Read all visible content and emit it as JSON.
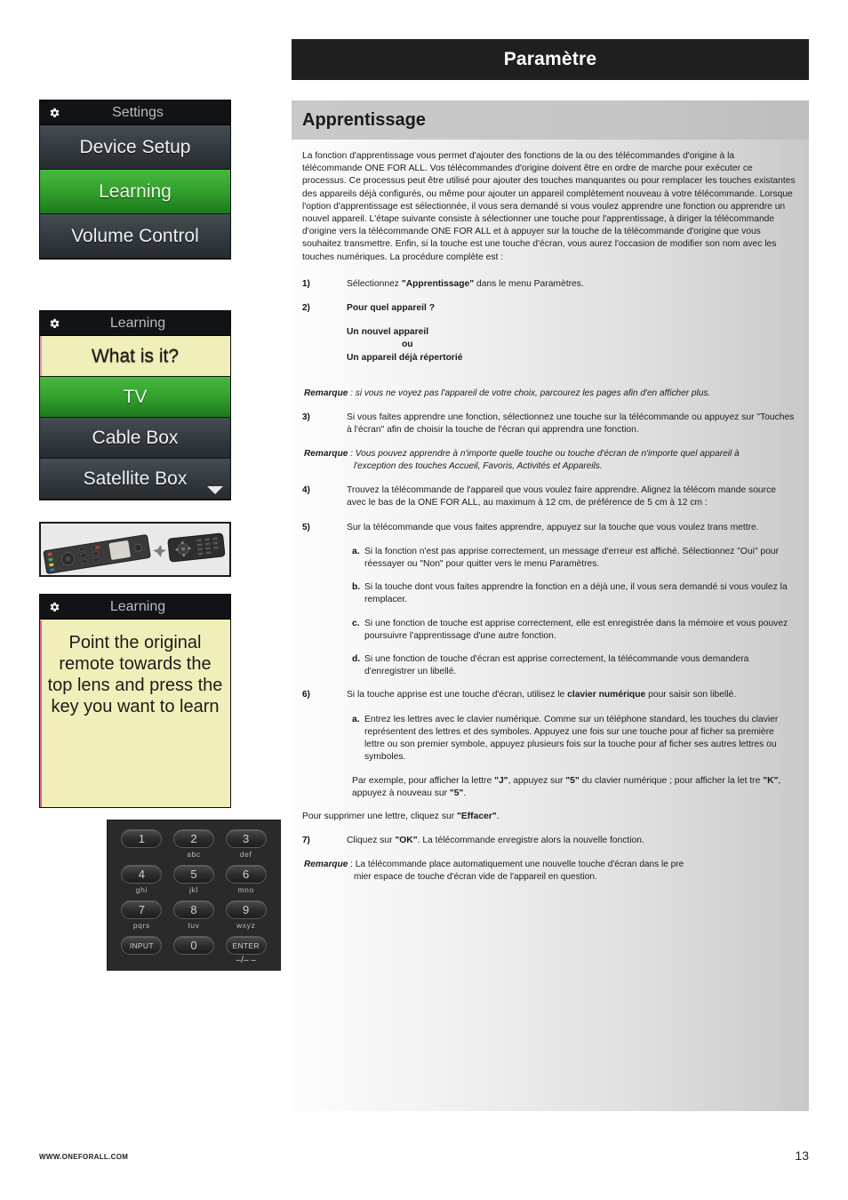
{
  "header": {
    "title": "Paramètre"
  },
  "section": {
    "title": "Apprentissage"
  },
  "intro": "La fonction d'apprentissage vous permet d'ajouter des fonctions de la ou des télécommandes d'origine à la télécommande ONE FOR ALL. Vos télécommandes d'origine doivent être en ordre de marche pour exécuter ce processus. Ce processus peut être utilisé pour ajouter des touches manquantes ou pour remplacer les touches existantes des appareils déjà configurés, ou même pour ajouter un appareil complètement nouveau à votre télécommande. Lorsque l'option d'apprentissage est sélectionnée, il vous sera demandé si vous voulez apprendre une fonction ou apprendre un nouvel appareil. L'étape suivante consiste à sélectionner une touche pour l'apprentissage, à diriger la télécommande d'origine vers la télécommande ONE FOR ALL et à appuyer sur la touche de la télécommande d'origine que vous souhaitez transmettre. Enfin, si la touche est une touche d'écran, vous aurez l'occasion de modifier son nom avec les touches numériques. La procédure complète est :",
  "steps": {
    "s1_num": "1)",
    "s1_a": "Sélectionnez ",
    "s1_b": "\"Apprentissage\"",
    "s1_c": " dans le menu Paramètres.",
    "s2_num": "2)",
    "s2_text": "Pour quel appareil ?",
    "s2_opt1": "Un nouvel appareil",
    "s2_or": "ou",
    "s2_opt2": "Un appareil déjà répertorié",
    "rem1_label": "Remarque",
    "rem1_text": " : si vous ne voyez pas l'appareil de votre choix, parcourez les pages afin d'en afficher plus.",
    "s3_num": "3)",
    "s3_text": "Si vous faites apprendre une fonction, sélectionnez une touche sur la télécommande ou appuyez sur \"Touches à l'écran\" afin de choisir la touche de l'écran qui apprendra une fonction.",
    "rem2_label": "Remarque",
    "rem2_text": " : Vous pouvez apprendre à n'importe quelle touche ou touche d'écran de n'importe quel appareil à",
    "rem2_text2": "l'exception des touches Accueil, Favoris, Activités et Appareils.",
    "s4_num": "4)",
    "s4_text": "Trouvez la télécommande de l'appareil que vous voulez faire apprendre. Alignez la télécom mande source avec le bas de la ONE FOR ALL, au maximum à 12 cm, de préférence de 5 cm à 12 cm :",
    "s5_num": "5)",
    "s5_text": "Sur la télécommande que vous faites apprendre, appuyez sur la touche que vous voulez trans mettre.",
    "s5a_ltr": "a.",
    "s5a_text": "Si la fonction n'est pas apprise correctement, un message d'erreur est affiché. Sélectionnez \"Oui\" pour réessayer ou \"Non\" pour quitter vers le menu Paramètres.",
    "s5b_ltr": "b.",
    "s5b_text": "Si la touche dont vous faites apprendre la fonction en a déjà une, il vous sera demandé si vous voulez la remplacer.",
    "s5c_ltr": "c.",
    "s5c_text": "Si une fonction de touche est apprise correctement, elle est enregistrée dans la mémoire et vous pouvez poursuivre l'apprentissage d'une autre fonction.",
    "s5d_ltr": "d.",
    "s5d_text": "Si une fonction de touche d'écran est apprise correctement, la télécommande vous demandera d'enregistrer un libellé.",
    "s6_num": "6)",
    "s6_a": "Si la touche apprise est une touche d'écran, utilisez le ",
    "s6_b": "clavier numérique",
    "s6_c": " pour saisir son libellé.",
    "s6a_ltr": "a.",
    "s6a_text": "Entrez les lettres avec le clavier numérique. Comme sur un téléphone standard, les touches du clavier représentent des lettres et des symboles. Appuyez une fois sur une touche pour af ficher sa première lettre ou son premier symbole, appuyez plusieurs fois sur la touche pour af ficher ses autres lettres ou symboles.",
    "ex_p1": "Par exemple, pour afficher la lettre ",
    "ex_j": "\"J\"",
    "ex_p2": ", appuyez sur ",
    "ex_5a": "\"5\"",
    "ex_p3": " du clavier numérique ; pour afficher la let tre ",
    "ex_k": "\"K\"",
    "ex_p4": ", appuyez à nouveau sur ",
    "ex_5b": "\"5\"",
    "ex_p5": ".",
    "del_p1": "Pour supprimer une lettre, cliquez sur ",
    "del_b": "\"Effacer\"",
    "del_p2": ".",
    "s7_num": "7)",
    "s7_a": "Cliquez sur ",
    "s7_b": "\"OK\"",
    "s7_c": ". La télécommande enregistre alors la nouvelle fonction.",
    "rem3_label": "Remarque",
    "rem3_text": " : La télécommande place automatiquement une nouvelle touche d'écran dans le pre",
    "rem3_text2": "mier espace de touche d'écran vide de l'appareil en question."
  },
  "screens": {
    "settings": {
      "header": "Settings",
      "rows": [
        {
          "label": "Device Setup",
          "state": "normal"
        },
        {
          "label": "Learning",
          "state": "selected"
        },
        {
          "label": "Volume Control",
          "state": "normal"
        }
      ]
    },
    "learning_list": {
      "header": "Learning",
      "rows": [
        {
          "label": "What is it?",
          "state": "prompt"
        },
        {
          "label": "TV",
          "state": "selected"
        },
        {
          "label": "Cable Box",
          "state": "normal"
        },
        {
          "label": "Satellite Box",
          "state": "normal"
        }
      ]
    },
    "learning_msg": {
      "header": "Learning",
      "message": "Point the original remote towards the top lens and press the key you want to learn"
    }
  },
  "keypad": {
    "keys": [
      {
        "label": "1",
        "sub": ""
      },
      {
        "label": "2",
        "sub": "abc"
      },
      {
        "label": "3",
        "sub": "def"
      },
      {
        "label": "4",
        "sub": "ghi"
      },
      {
        "label": "5",
        "sub": "jkl"
      },
      {
        "label": "6",
        "sub": "mno"
      },
      {
        "label": "7",
        "sub": "pqrs"
      },
      {
        "label": "8",
        "sub": "tuv"
      },
      {
        "label": "9",
        "sub": "wxyz"
      },
      {
        "label": "INPUT",
        "sub": ""
      },
      {
        "label": "0",
        "sub": ""
      },
      {
        "label": "ENTER",
        "sub": "–/– –"
      }
    ]
  },
  "footer": {
    "url": "WWW.ONEFORALL.COM",
    "page": "13"
  },
  "colors": {
    "header_bg": "#1f1f1f",
    "selected_green": "#35a32f",
    "prompt_yellow": "#f1efb9",
    "screen_dark": "#2c3338"
  }
}
